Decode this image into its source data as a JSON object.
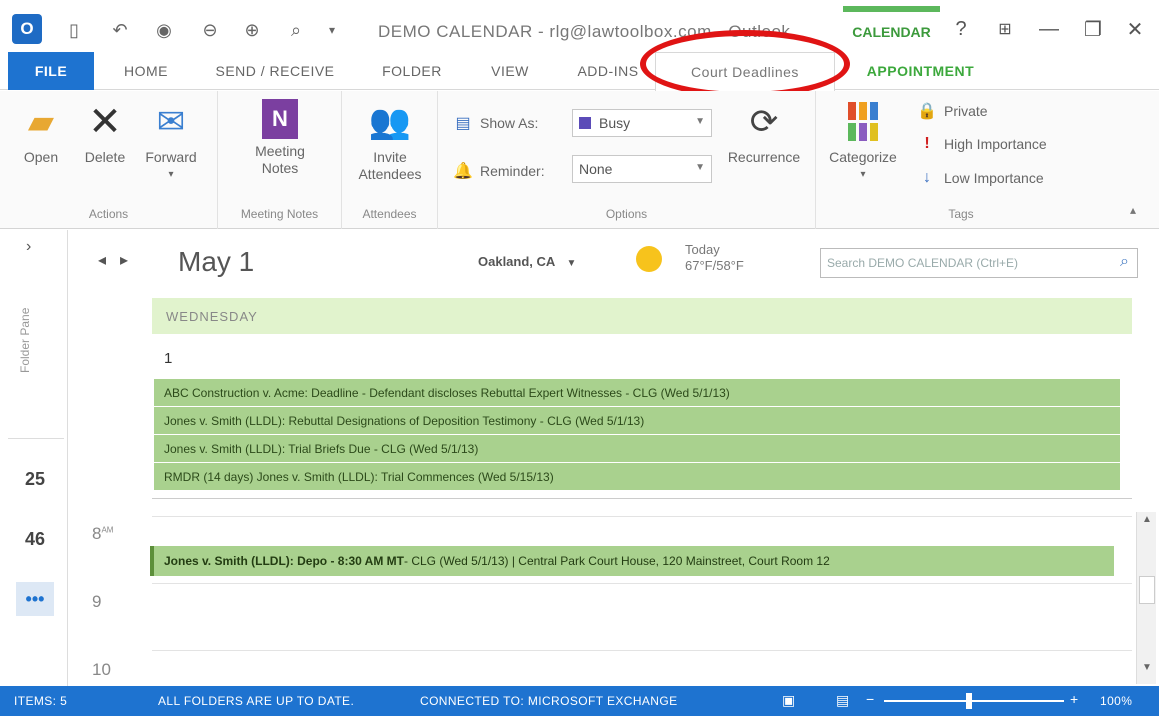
{
  "titlebar": {
    "window_title": "DEMO CALENDAR - rlg@lawtoolbox.com - Outlook",
    "calendar_tools": "CALENDAR",
    "help": "?",
    "ribbon_options": "⊞",
    "minimize": "—",
    "restore": "❐",
    "close": "✕"
  },
  "tabs": {
    "file": "FILE",
    "home": "HOME",
    "send_receive": "SEND / RECEIVE",
    "folder": "FOLDER",
    "view": "VIEW",
    "add_ins": "ADD-INS",
    "court_deadlines": "Court Deadlines",
    "appointment": "APPOINTMENT"
  },
  "ribbon": {
    "actions": {
      "label": "Actions",
      "open": "Open",
      "delete": "Delete",
      "forward": "Forward"
    },
    "meeting_notes": {
      "label": "Meeting Notes",
      "button": "Meeting Notes"
    },
    "attendees": {
      "label": "Attendees",
      "button": "Invite Attendees"
    },
    "options": {
      "label": "Options",
      "show_as_label": "Show As:",
      "show_as_value": "Busy",
      "reminder_label": "Reminder:",
      "reminder_value": "None",
      "recurrence": "Recurrence"
    },
    "tags": {
      "label": "Tags",
      "categorize": "Categorize",
      "private": "Private",
      "high_importance": "High Importance",
      "low_importance": "Low Importance"
    }
  },
  "leftnav": {
    "folder_pane_label": "Folder Pane",
    "icon_1": "25",
    "icon_2": "46",
    "icon_3": "•••"
  },
  "header": {
    "date": "May 1",
    "weather_city": "Oakland, CA",
    "weather_today_label": "Today",
    "weather_today_temp": "67°F/58°F",
    "search_placeholder": "Search DEMO CALENDAR (Ctrl+E)"
  },
  "calendar": {
    "day_name": "WEDNESDAY",
    "day_number": "1",
    "all_day_events": [
      "ABC Construction v. Acme: Deadline - Defendant discloses Rebuttal Expert Witnesses - CLG (Wed 5/1/13)",
      "Jones v. Smith (LLDL): Rebuttal Designations of Deposition Testimony - CLG (Wed 5/1/13)",
      "Jones v. Smith (LLDL): Trial Briefs Due - CLG (Wed 5/1/13)",
      "RMDR (14 days) Jones v. Smith (LLDL): Trial Commences (Wed 5/15/13)"
    ],
    "hours": [
      "8",
      "9",
      "10"
    ],
    "hour_suffix_8": "AM",
    "timed_event_bold": "Jones v. Smith (LLDL): Depo - 8:30 AM MT",
    "timed_event_rest": " - CLG (Wed 5/1/13) | Central Park Court House, 120 Mainstreet, Court Room 12"
  },
  "statusbar": {
    "items": "ITEMS: 5",
    "folders": "ALL FOLDERS ARE UP TO DATE.",
    "connection": "CONNECTED TO: MICROSOFT EXCHANGE",
    "zoom": "100%"
  },
  "colors": {
    "accent": "#1e73d0",
    "event_green": "#a9d18e",
    "day_header_green": "#e1f3cd",
    "highlight_red": "#e01414"
  }
}
